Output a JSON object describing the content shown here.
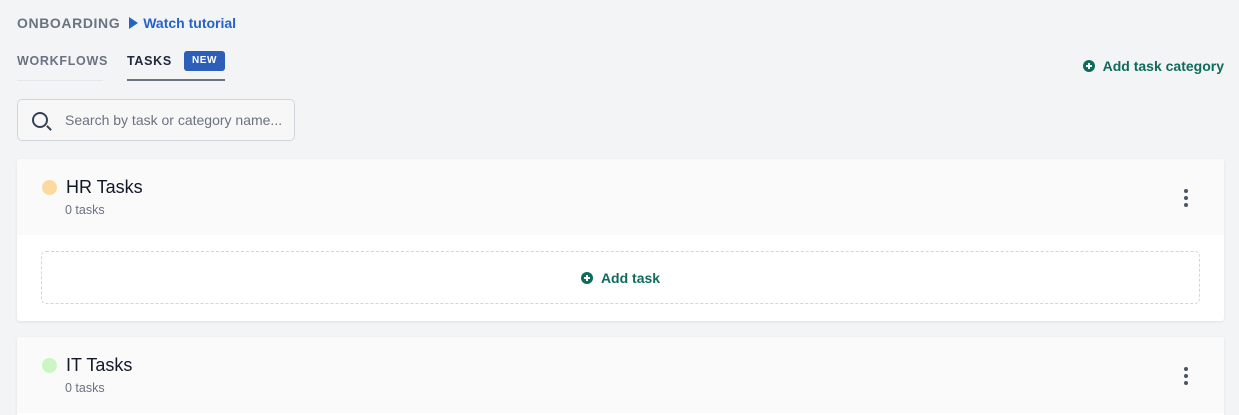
{
  "header": {
    "section": "ONBOARDING",
    "tutorial_label": "Watch tutorial"
  },
  "tabs": [
    {
      "label": "WORKFLOWS",
      "active": false
    },
    {
      "label": "TASKS",
      "active": true,
      "badge": "NEW"
    }
  ],
  "actions": {
    "add_category_label": "Add task category"
  },
  "search": {
    "placeholder": "Search by task or category name..."
  },
  "categories": [
    {
      "title": "HR Tasks",
      "count": "0 tasks",
      "dot_color": "#fcd9a0",
      "add_label": "Add task"
    },
    {
      "title": "IT Tasks",
      "count": "0 tasks",
      "dot_color": "#cdf5c4"
    }
  ],
  "colors": {
    "accent_green": "#0f6b5c",
    "link_blue": "#2563c9",
    "badge_blue": "#2d5fb8"
  }
}
